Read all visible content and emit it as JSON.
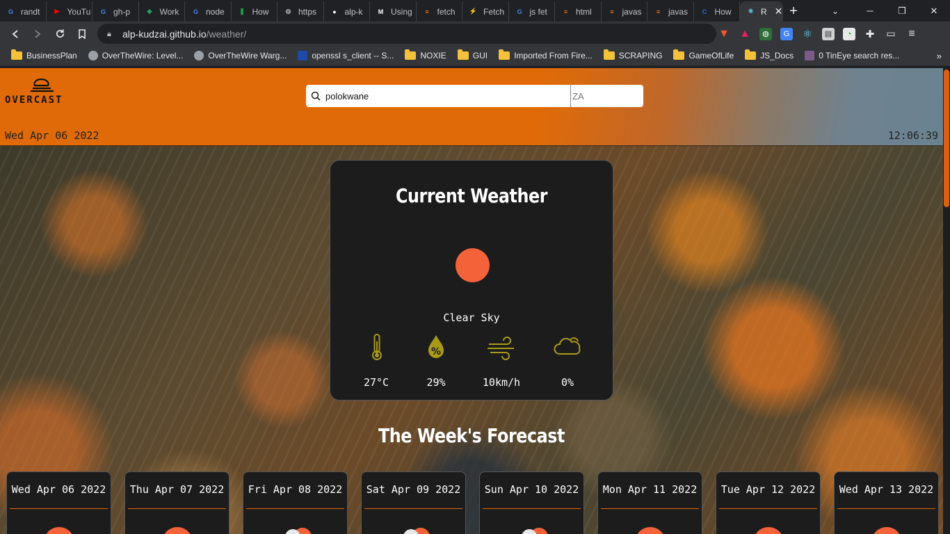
{
  "browser": {
    "tabs": [
      {
        "label": "randt",
        "icon": "google-icon",
        "color": "#4285f4",
        "glyph": "G"
      },
      {
        "label": "YouTu",
        "icon": "youtube-icon",
        "color": "#ff0000",
        "glyph": "▶"
      },
      {
        "label": "gh-p",
        "icon": "google-icon",
        "color": "#4285f4",
        "glyph": "G"
      },
      {
        "label": "Work",
        "icon": "drive-icon",
        "color": "#1fa463",
        "glyph": "◆"
      },
      {
        "label": "node",
        "icon": "google-icon",
        "color": "#4285f4",
        "glyph": "G"
      },
      {
        "label": "How",
        "icon": "mongodb-icon",
        "color": "#13aa52",
        "glyph": "❚"
      },
      {
        "label": "https",
        "icon": "globe-icon",
        "color": "#9aa0a6",
        "glyph": "◍"
      },
      {
        "label": "alp-k",
        "icon": "github-icon",
        "color": "#ffffff",
        "glyph": "●"
      },
      {
        "label": "Using",
        "icon": "medium-icon",
        "color": "#ffffff",
        "glyph": "M"
      },
      {
        "label": "fetch",
        "icon": "stackoverflow-icon",
        "color": "#f48024",
        "glyph": "≡"
      },
      {
        "label": "Fetch",
        "icon": "bolt-icon",
        "color": "#f7df1e",
        "glyph": "⚡"
      },
      {
        "label": "js fet",
        "icon": "google-icon",
        "color": "#4285f4",
        "glyph": "G"
      },
      {
        "label": "html",
        "icon": "stackoverflow-icon",
        "color": "#f48024",
        "glyph": "≡"
      },
      {
        "label": "javas",
        "icon": "stackoverflow-icon",
        "color": "#f48024",
        "glyph": "≡"
      },
      {
        "label": "javas",
        "icon": "stackoverflow-icon",
        "color": "#f48024",
        "glyph": "≡"
      },
      {
        "label": "How",
        "icon": "blue-c-icon",
        "color": "#1a73e8",
        "glyph": "C"
      },
      {
        "label": "R",
        "icon": "react-icon",
        "color": "#61dafb",
        "glyph": "⚛",
        "active": true
      }
    ],
    "url_host": "alp-kudzai.github.io",
    "url_path": "/weather/",
    "bookmarks": [
      {
        "label": "BusinessPlan",
        "icon": "folder-icon"
      },
      {
        "label": "OverTheWire: Level...",
        "icon": "globe-icon"
      },
      {
        "label": "OverTheWire Warg...",
        "icon": "globe-icon"
      },
      {
        "label": "openssl s_client -- S...",
        "icon": "openssl-icon"
      },
      {
        "label": "NOXIE",
        "icon": "folder-icon"
      },
      {
        "label": "GUI",
        "icon": "folder-icon"
      },
      {
        "label": "Imported From Fire...",
        "icon": "folder-icon"
      },
      {
        "label": "SCRAPING",
        "icon": "folder-icon"
      },
      {
        "label": "GameOfLife",
        "icon": "folder-icon"
      },
      {
        "label": "JS_Docs",
        "icon": "folder-icon"
      },
      {
        "label": "0 TinEye search res...",
        "icon": "tineye-icon"
      }
    ]
  },
  "site": {
    "logo_text": "OVERCAST",
    "search_value": "polokwane",
    "country_placeholder": "ZA",
    "date": "Wed Apr 06 2022",
    "time": "12:06:39"
  },
  "current": {
    "title": "Current Weather",
    "condition": "Clear Sky",
    "stats": [
      {
        "icon": "thermometer-icon",
        "value": "27°C"
      },
      {
        "icon": "humidity-icon",
        "value": "29%"
      },
      {
        "icon": "wind-icon",
        "value": "10km/h"
      },
      {
        "icon": "cloud-icon",
        "value": "0%"
      }
    ]
  },
  "forecast": {
    "title": "The Week's Forecast",
    "days": [
      {
        "label": "Wed Apr 06 2022",
        "icon": "sun-icon"
      },
      {
        "label": "Thu Apr 07 2022",
        "icon": "sun-icon"
      },
      {
        "label": "Fri Apr 08 2022",
        "icon": "partly-cloudy-icon"
      },
      {
        "label": "Sat Apr 09 2022",
        "icon": "partly-cloudy-icon"
      },
      {
        "label": "Sun Apr 10 2022",
        "icon": "partly-cloudy-icon"
      },
      {
        "label": "Mon Apr 11 2022",
        "icon": "sun-icon"
      },
      {
        "label": "Tue Apr 12 2022",
        "icon": "sun-icon"
      },
      {
        "label": "Wed Apr 13 2022",
        "icon": "sun-icon"
      }
    ]
  },
  "colors": {
    "accent": "#e06a08",
    "sun": "#f4623a",
    "icon_olive": "#a89a17",
    "card_bg": "#1c1c1c"
  }
}
